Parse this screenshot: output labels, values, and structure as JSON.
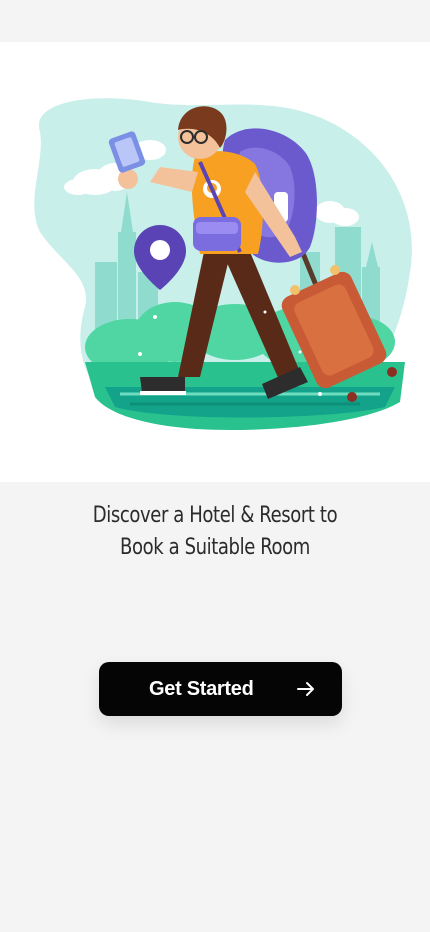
{
  "onboarding": {
    "headline_line1": "Discover a Hotel & Resort to",
    "headline_line2": "Book a Suitable Room",
    "illustration": "traveler-with-backpack-and-suitcase",
    "cta_label": "Get Started",
    "cta_icon": "arrow-right-icon"
  },
  "colors": {
    "background": "#f4f4f4",
    "hero_background": "#ffffff",
    "button": "#050505",
    "button_text": "#ffffff",
    "headline_text": "#2b2b2b",
    "blob": "#c7eeea",
    "greenery": "#3ccf9a",
    "backpack": "#6a5acd",
    "shirt": "#f7a021",
    "suitcase": "#c85a36",
    "pin": "#5a43b5"
  }
}
